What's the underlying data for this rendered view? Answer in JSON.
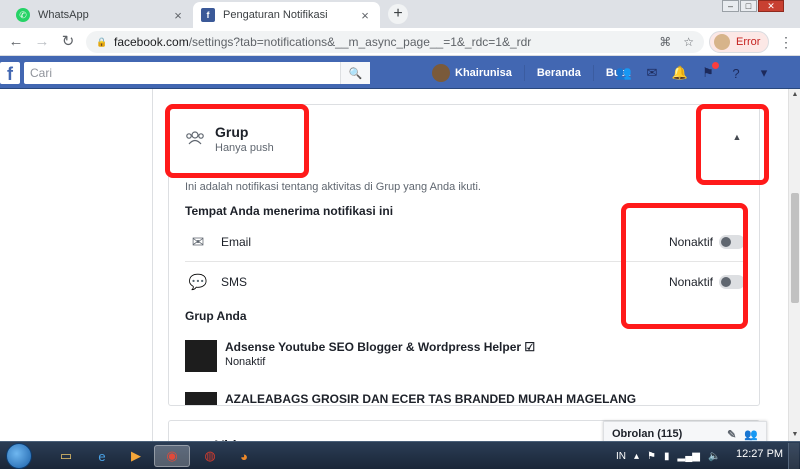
{
  "browser": {
    "tabs": [
      {
        "title": "WhatsApp",
        "favicon": "whatsapp-icon",
        "active": false
      },
      {
        "title": "Pengaturan Notifikasi",
        "favicon": "facebook-icon",
        "active": true
      }
    ],
    "window_controls": [
      "–",
      "□",
      "✕"
    ],
    "url_host": "facebook.com",
    "url_path": "/settings?tab=notifications&__m_async_page__=1&_rdc=1&_rdr",
    "profile_button_label": "Error"
  },
  "facebook": {
    "logo": "f",
    "search_placeholder": "Cari",
    "user_name": "Khairunisa",
    "nav_links": [
      "Beranda",
      "Buat"
    ]
  },
  "section": {
    "title": "Grup",
    "subtitle": "Hanya push",
    "description": "Ini adalah notifikasi tentang aktivitas di Grup yang Anda ikuti.",
    "receive_heading": "Tempat Anda menerima notifikasi ini",
    "channels": [
      {
        "label": "Email",
        "status": "Nonaktif",
        "enabled": false,
        "icon": "envelope-icon"
      },
      {
        "label": "SMS",
        "status": "Nonaktif",
        "enabled": false,
        "icon": "sms-bubble-icon"
      }
    ],
    "groups_heading": "Grup Anda",
    "groups": [
      {
        "name": "Adsense Youtube SEO Blogger & Wordpress Helper ☑",
        "status": "Nonaktif"
      },
      {
        "name": "AZALEABAGS GROSIR DAN ECER TAS BRANDED MURAH MAGELANG",
        "status": ""
      }
    ]
  },
  "next_section": {
    "title": "Video"
  },
  "chat": {
    "label": "Obrolan (115)"
  },
  "taskbar": {
    "language": "IN",
    "time": "12:27 PM"
  },
  "colors": {
    "fb_blue": "#4267b2",
    "annotation_red": "#ff1a1a"
  }
}
